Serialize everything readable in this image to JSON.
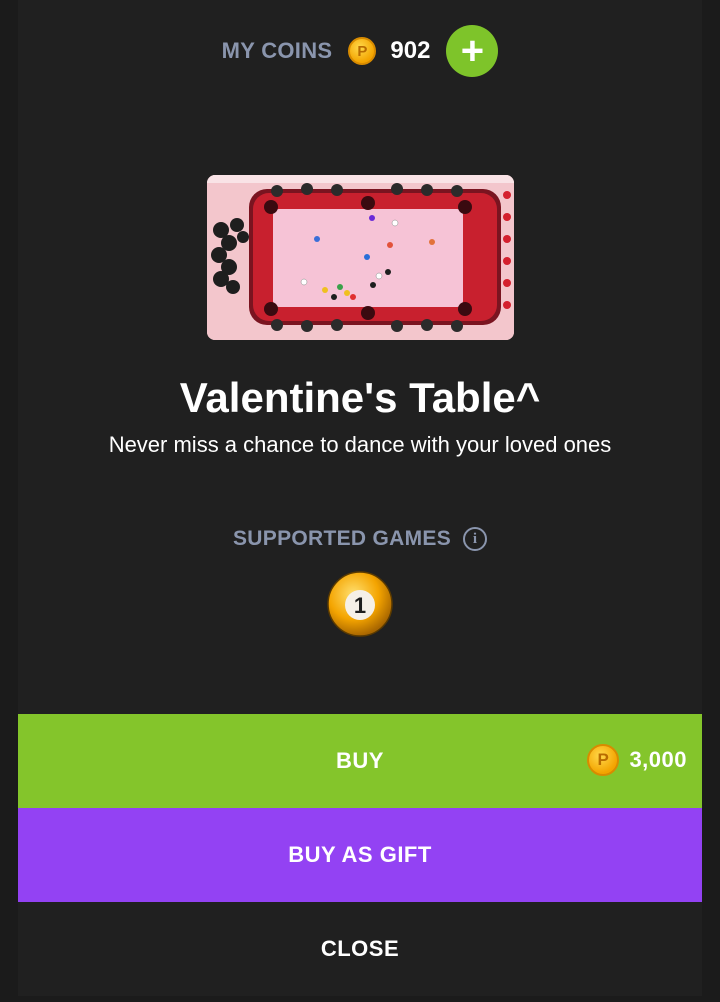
{
  "header": {
    "coins_label": "MY COINS",
    "coin_symbol": "P",
    "coins_value": "902",
    "add_symbol": "+"
  },
  "item": {
    "title": "Valentine's Table^",
    "description": "Never miss a chance to dance with your loved ones"
  },
  "supported": {
    "label": "SUPPORTED GAMES",
    "info_symbol": "i",
    "game_ball_number": "1"
  },
  "buttons": {
    "buy_label": "BUY",
    "buy_price": "3,000",
    "gift_label": "BUY AS GIFT",
    "close_label": "CLOSE"
  },
  "colors": {
    "buy": "#84c52b",
    "gift": "#9342f3",
    "add": "#7ec42a",
    "muted_label": "#8a95ad",
    "background": "#202020"
  },
  "icons": [
    "coin-icon",
    "add-coins-icon",
    "info-icon",
    "pool-ball-icon"
  ]
}
